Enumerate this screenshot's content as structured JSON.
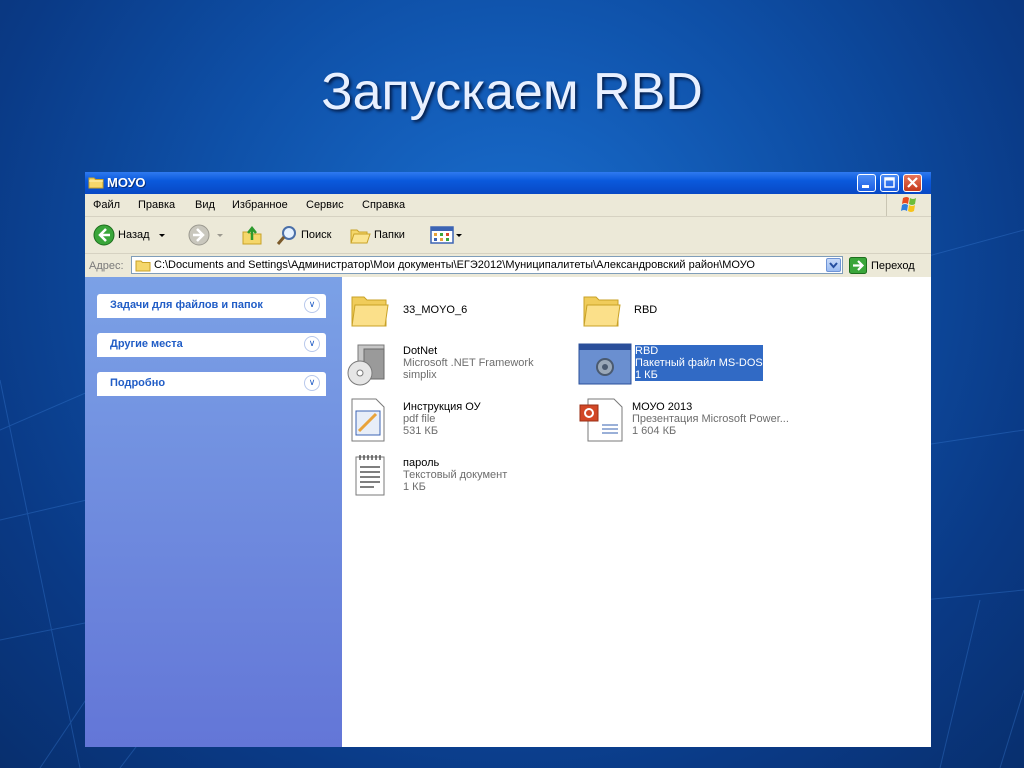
{
  "slide": {
    "title": "Запускаем RBD"
  },
  "window": {
    "title": "МОУО",
    "menu": [
      "Файл",
      "Правка",
      "Вид",
      "Избранное",
      "Сервис",
      "Справка"
    ],
    "toolbar": {
      "back_label": "Назад",
      "search_label": "Поиск",
      "folders_label": "Папки"
    },
    "address": {
      "label": "Адрес:",
      "path": "C:\\Documents and Settings\\Администратор\\Мои документы\\ЕГЭ2012\\Муниципалитеты\\Александровский район\\МОУО",
      "go_label": "Переход"
    },
    "tasks": [
      {
        "title": "Задачи для файлов и папок"
      },
      {
        "title": "Другие места"
      },
      {
        "title": "Подробно"
      }
    ],
    "files": [
      {
        "name": "33_MOYO_6",
        "icon": "folder-icon",
        "lines": []
      },
      {
        "name": "RBD",
        "icon": "folder-icon",
        "lines": []
      },
      {
        "name": "DotNet",
        "icon": "installer-icon",
        "lines": [
          "Microsoft .NET Framework",
          "simplix"
        ]
      },
      {
        "name": "RBD",
        "icon": "batch-file-icon",
        "lines": [
          "Пакетный файл MS-DOS",
          "1 КБ"
        ],
        "selected": true
      },
      {
        "name": "Инструкция ОУ",
        "icon": "pdf-icon",
        "lines": [
          "pdf file",
          "531 КБ"
        ]
      },
      {
        "name": "МОУО 2013",
        "icon": "powerpoint-icon",
        "lines": [
          "Презентация Microsoft Power...",
          "1 604 КБ"
        ]
      },
      {
        "name": "пароль",
        "icon": "text-document-icon",
        "lines": [
          "Текстовый документ",
          "1 КБ"
        ]
      }
    ]
  },
  "colors": {
    "slide_background": "#0e4fa6",
    "titlebar": "#0a59dc",
    "task_pane": "#6f8ddf",
    "selection": "#316ac5"
  }
}
